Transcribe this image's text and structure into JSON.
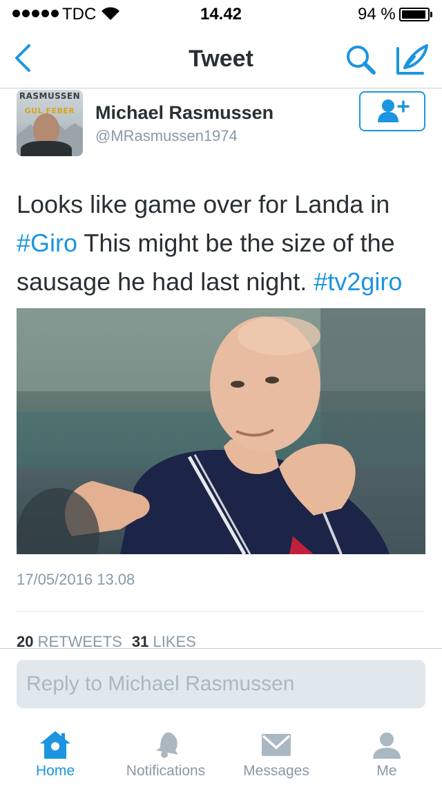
{
  "status_bar": {
    "carrier": "TDC",
    "time": "14.42",
    "battery": "94 %",
    "battery_level": 0.94
  },
  "nav": {
    "title": "Tweet",
    "back_icon": "chevron-left-icon",
    "search_icon": "search-icon",
    "compose_icon": "compose-icon"
  },
  "author": {
    "name": "Michael Rasmussen",
    "handle": "@MRasmussen1974",
    "avatar_text": "RASMUSSEN",
    "avatar_subtext": "GUL FEBER",
    "follow_icon": "add-user-icon"
  },
  "tweet": {
    "text_1": "Looks like game over for Landa in ",
    "hashtag_1": "#Giro",
    "text_2": " This might be the size of the sausage he had last night. ",
    "hashtag_2": "#tv2giro",
    "timestamp": "17/05/2016 13.08"
  },
  "stats": {
    "retweets_count": "20",
    "retweets_label": "RETWEETS",
    "likes_count": "31",
    "likes_label": "LIKES"
  },
  "reply": {
    "placeholder": "Reply to Michael Rasmussen"
  },
  "tabs": [
    {
      "label": "Home",
      "icon": "home-icon"
    },
    {
      "label": "Notifications",
      "icon": "bell-icon"
    },
    {
      "label": "Messages",
      "icon": "envelope-icon"
    },
    {
      "label": "Me",
      "icon": "person-icon"
    }
  ],
  "colors": {
    "accent": "#1b95e0",
    "muted": "#8899a6",
    "text": "#292f33",
    "inactive_icon": "#aab8c2"
  }
}
